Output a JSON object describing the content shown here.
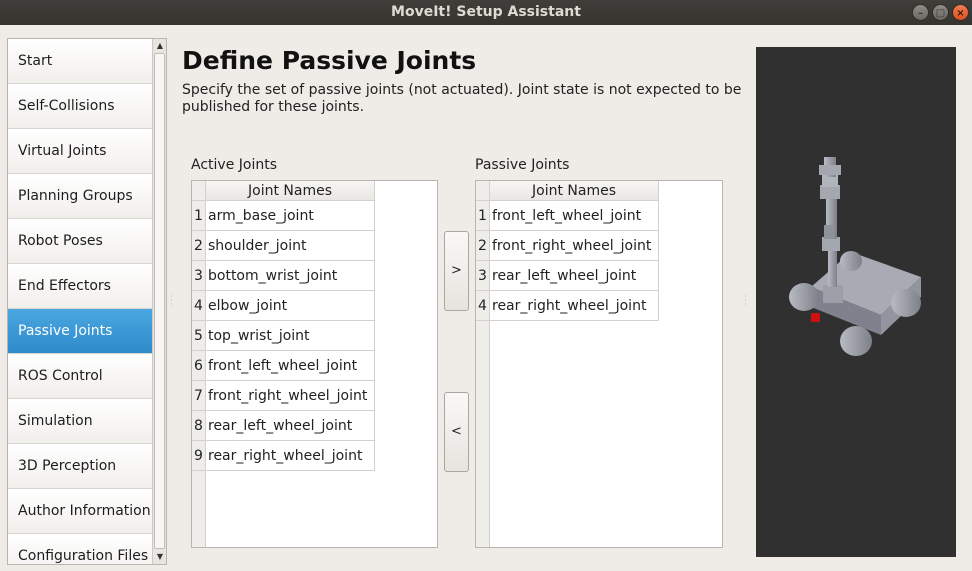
{
  "window": {
    "title": "MoveIt! Setup Assistant",
    "buttons": {
      "minimize": "–",
      "maximize": "□",
      "close": "×"
    }
  },
  "sidebar": {
    "items": [
      {
        "label": "Start",
        "active": false
      },
      {
        "label": "Self-Collisions",
        "active": false
      },
      {
        "label": "Virtual Joints",
        "active": false
      },
      {
        "label": "Planning Groups",
        "active": false
      },
      {
        "label": "Robot Poses",
        "active": false
      },
      {
        "label": "End Effectors",
        "active": false
      },
      {
        "label": "Passive Joints",
        "active": true
      },
      {
        "label": "ROS Control",
        "active": false
      },
      {
        "label": "Simulation",
        "active": false
      },
      {
        "label": "3D Perception",
        "active": false
      },
      {
        "label": "Author Information",
        "active": false
      },
      {
        "label": "Configuration Files",
        "active": false
      }
    ]
  },
  "main": {
    "title": "Define Passive Joints",
    "description": "Specify the set of passive joints (not actuated). Joint state is not expected to be published for these joints.",
    "active_joints": {
      "label": "Active Joints",
      "column_header": "Joint Names",
      "rows": [
        {
          "num": "1",
          "name": "arm_base_joint"
        },
        {
          "num": "2",
          "name": "shoulder_joint"
        },
        {
          "num": "3",
          "name": "bottom_wrist_joint"
        },
        {
          "num": "4",
          "name": "elbow_joint"
        },
        {
          "num": "5",
          "name": "top_wrist_joint"
        },
        {
          "num": "6",
          "name": "front_left_wheel_joint"
        },
        {
          "num": "7",
          "name": "front_right_wheel_joint"
        },
        {
          "num": "8",
          "name": "rear_left_wheel_joint"
        },
        {
          "num": "9",
          "name": "rear_right_wheel_joint"
        }
      ]
    },
    "passive_joints": {
      "label": "Passive Joints",
      "column_header": "Joint Names",
      "rows": [
        {
          "num": "1",
          "name": "front_left_wheel_joint"
        },
        {
          "num": "2",
          "name": "front_right_wheel_joint"
        },
        {
          "num": "3",
          "name": "rear_left_wheel_joint"
        },
        {
          "num": "4",
          "name": "rear_right_wheel_joint"
        }
      ]
    },
    "buttons": {
      "move_right": ">",
      "move_left": "<"
    }
  },
  "viewer": {
    "background": "#303030",
    "robot_color": "#9a9ca6",
    "marker_color": "#d01010"
  }
}
